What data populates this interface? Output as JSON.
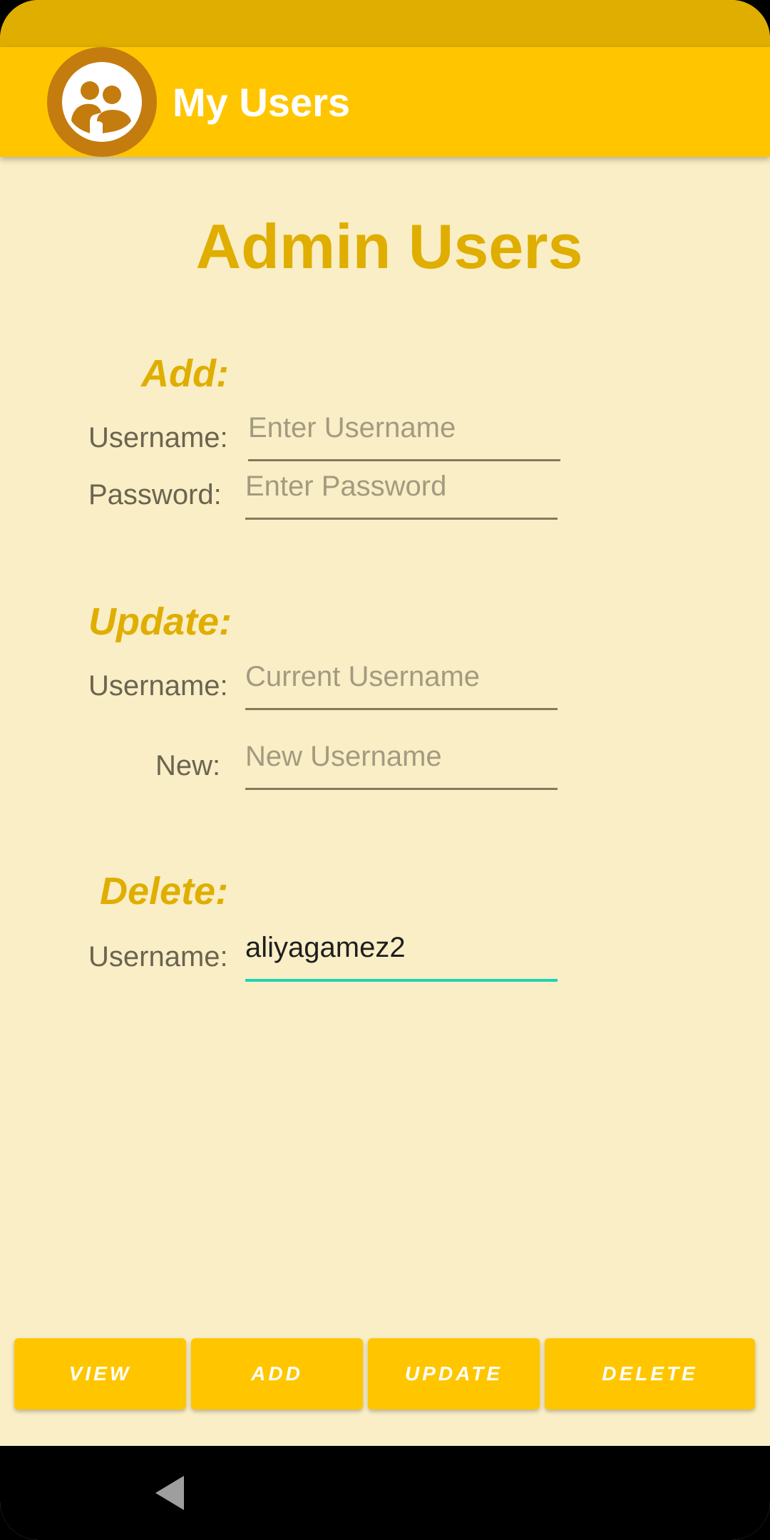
{
  "app": {
    "title": "My Users",
    "logo_icon": "user-group-icon"
  },
  "page": {
    "heading": "Admin Users"
  },
  "add_section": {
    "title": "Add:",
    "username_label": "Username:",
    "username_placeholder": "Enter Username",
    "password_label": "Password:",
    "password_placeholder": "Enter Password"
  },
  "update_section": {
    "title": "Update:",
    "username_label": "Username:",
    "username_placeholder": "Current Username",
    "new_label": "New:",
    "new_placeholder": "New Username"
  },
  "delete_section": {
    "title": "Delete:",
    "username_label": "Username:",
    "username_value": "aliyagamez2"
  },
  "buttons": {
    "view": "VIEW",
    "add": "ADD",
    "update": "UPDATE",
    "delete": "DELETE"
  },
  "colors": {
    "primary": "#FFC600",
    "primary_dark": "#DFAE00",
    "background": "#FAEEC6",
    "accent": "#1ED3B4",
    "logo_ring": "#C47C0E"
  },
  "nav": {
    "back_icon": "back-triangle-icon"
  }
}
